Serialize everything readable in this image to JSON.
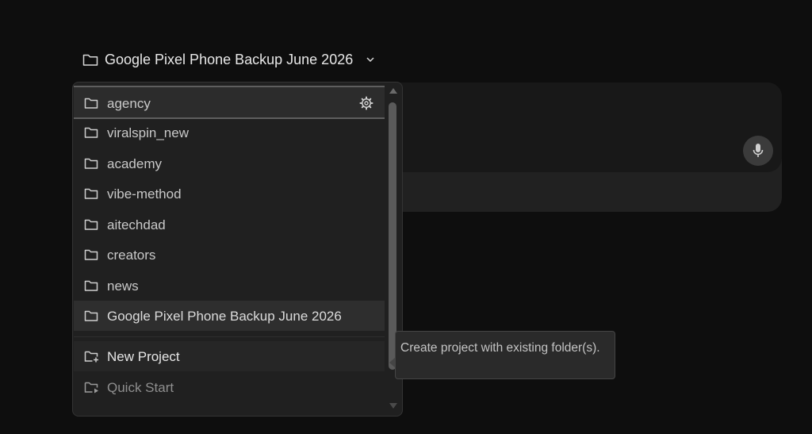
{
  "selector": {
    "current_project": "Google Pixel Phone Backup June 2026"
  },
  "dropdown": {
    "items": [
      {
        "label": "agency"
      },
      {
        "label": "viralspin_new"
      },
      {
        "label": "academy"
      },
      {
        "label": "vibe-method"
      },
      {
        "label": "aitechdad"
      },
      {
        "label": "creators"
      },
      {
        "label": "news"
      },
      {
        "label": "Google Pixel Phone Backup June 2026"
      }
    ],
    "actions": [
      {
        "label": "New Project"
      },
      {
        "label": "Quick Start"
      }
    ]
  },
  "tooltip": {
    "text": "Create project with existing folder(s)."
  },
  "icons": {
    "folder": "folder-icon",
    "gear": "gear-icon",
    "chevron": "chevron-down-icon",
    "mic": "microphone-icon",
    "new_project": "folder-plus-icon",
    "quick_start": "folder-play-icon"
  },
  "colors": {
    "background": "#0e0e0e",
    "panel": "#202020",
    "highlight": "#2c2c2c",
    "text": "#c9c9c9"
  }
}
